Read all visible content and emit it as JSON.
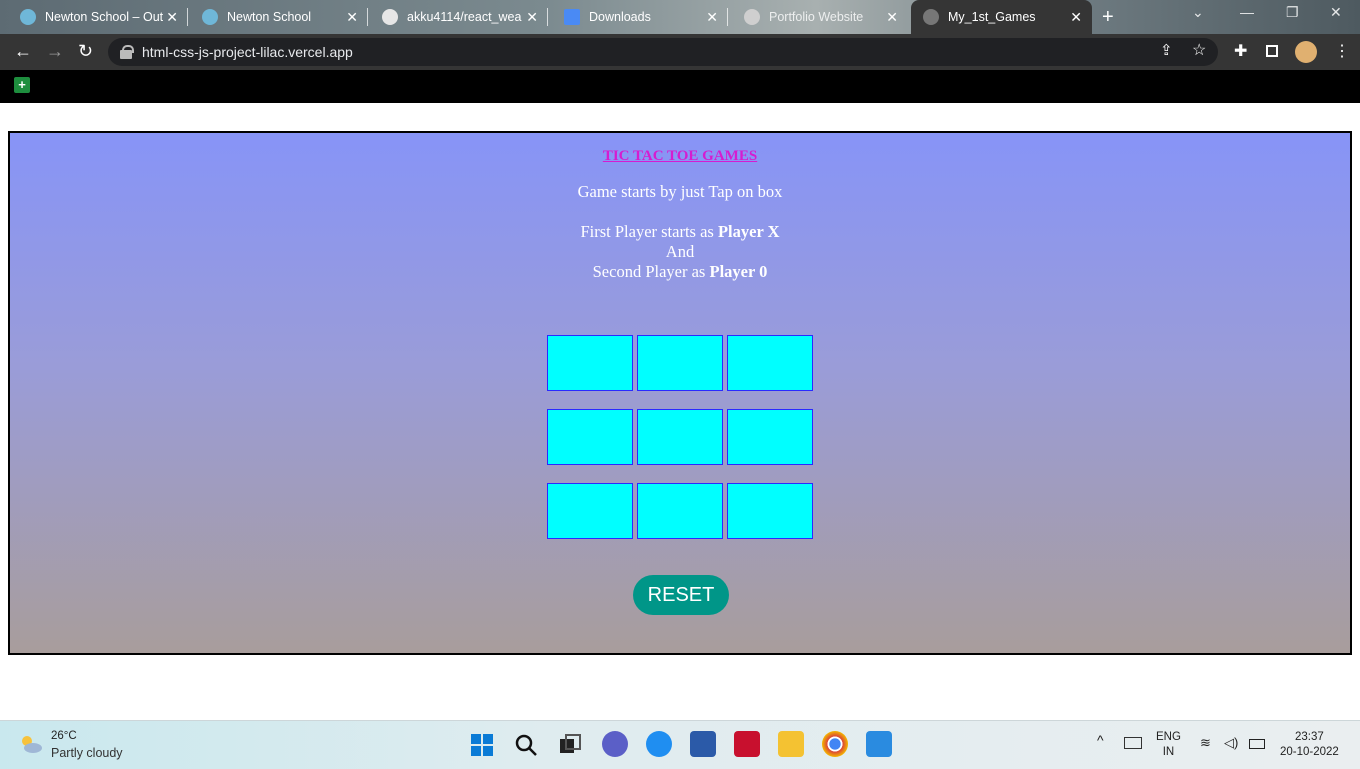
{
  "browser": {
    "tabs": [
      {
        "title": "Newton School – Outc",
        "favicon_color": "#6fb7d8",
        "active": false
      },
      {
        "title": "Newton School",
        "favicon_color": "#6fb7d8",
        "active": false
      },
      {
        "title": "akku4114/react_wea",
        "favicon_color": "#e6e6e6",
        "active": false
      },
      {
        "title": "Downloads",
        "favicon_color": "#4a8af4",
        "active": false
      },
      {
        "title": "Portfolio Website",
        "favicon_color": "#cfcfcf",
        "active": false
      },
      {
        "title": "My_1st_Games",
        "favicon_color": "#777777",
        "active": true
      }
    ],
    "url": "html-css-js-project-lilac.vercel.app"
  },
  "game": {
    "title": "TIC TAC TOE GAMES",
    "intro": "Game starts by just Tap on box",
    "first_prefix": "First Player starts as ",
    "first_player": "Player X",
    "and": "And",
    "second_prefix": "Second Player as ",
    "second_player": "Player 0",
    "cells": [
      "",
      "",
      "",
      "",
      "",
      "",
      "",
      "",
      ""
    ],
    "reset_label": "RESET",
    "colors": {
      "cell": "#00ffff",
      "reset": "#009688",
      "title": "#d61cd0"
    }
  },
  "taskbar": {
    "temperature": "26°C",
    "condition": "Partly cloudy",
    "language": "ENG",
    "region": "IN",
    "time": "23:37",
    "date": "20-10-2022"
  }
}
